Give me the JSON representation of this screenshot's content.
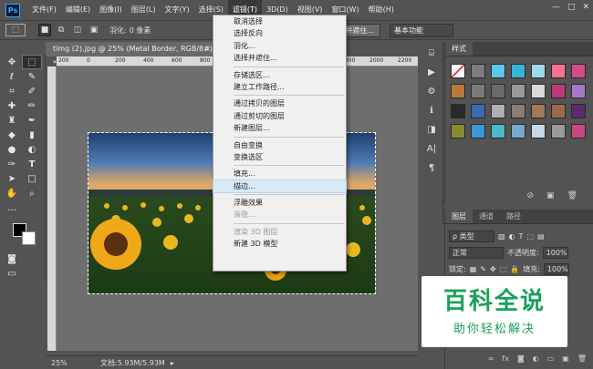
{
  "app": {
    "logo": "Ps"
  },
  "menubar": {
    "items": [
      "文件(F)",
      "编辑(E)",
      "图像(I)",
      "图层(L)",
      "文字(Y)",
      "选择(S)",
      "滤镜(T)",
      "3D(D)",
      "视图(V)",
      "窗口(W)",
      "帮助(H)"
    ],
    "active_index": 6
  },
  "window_controls": {
    "minimize": "—",
    "maximize": "□",
    "close": "✕"
  },
  "options_bar": {
    "feather_label": "羽化:",
    "feather_value": "0 像素",
    "select_mask_button": "选择并遮住...",
    "workspace": "基本功能"
  },
  "document": {
    "tab_title": "timg (2).jpg @ 25% (Metal Border, RGB/8#) *",
    "zoom": "25%",
    "doc_info": "文档:5.93M/5.93M",
    "ruler_ticks": [
      "200",
      "0",
      "200",
      "400",
      "600",
      "800",
      "1000",
      "1200",
      "1400",
      "1600",
      "1800",
      "2000",
      "2200"
    ]
  },
  "context_menu": {
    "groups": [
      [
        {
          "label": "取消选择"
        },
        {
          "label": "选择反向"
        },
        {
          "label": "羽化..."
        },
        {
          "label": "选择并遮住..."
        }
      ],
      [
        {
          "label": "存储选区..."
        },
        {
          "label": "建立工作路径..."
        }
      ],
      [
        {
          "label": "通过拷贝的图层"
        },
        {
          "label": "通过剪切的图层"
        },
        {
          "label": "新建图层..."
        }
      ],
      [
        {
          "label": "自由变换"
        },
        {
          "label": "变换选区"
        }
      ],
      [
        {
          "label": "填充..."
        },
        {
          "label": "描边...",
          "highlighted": true
        }
      ],
      [
        {
          "label": "浮雕效果"
        },
        {
          "label": "渐隐...",
          "disabled": true
        }
      ],
      [
        {
          "label": "渲染 3D 图层",
          "disabled": true
        },
        {
          "label": "新建 3D 模型"
        }
      ]
    ]
  },
  "styles_panel": {
    "tab": "样式",
    "swatches": [
      "#ffffff",
      "#7d7d7d",
      "#5ac8e8",
      "#35b6d6",
      "#9ed9e8",
      "#ff6f8f",
      "#d64a8a",
      "#b87a3a",
      "#7a7a7a",
      "#6a6a6a",
      "#9a9a9a",
      "#d9d9d9",
      "#c0367a",
      "#a878c8",
      "#2a2a2a",
      "#3a6ab0",
      "#b0b0b0",
      "#8a7e70",
      "#a07a5a",
      "#9a6a4a",
      "#5a2a6a",
      "#8a8a30",
      "#3a98d8",
      "#4ab8c8",
      "#78a8d0",
      "#c8d8e8",
      "#9a9a9a",
      "#c84880"
    ]
  },
  "layers_panel": {
    "tabs": [
      "图层",
      "通道",
      "路径"
    ],
    "filter_label": "ρ 类型",
    "blend_mode": "正常",
    "opacity_label": "不透明度:",
    "opacity_value": "100%",
    "lock_label": "锁定:",
    "fill_label": "填充:",
    "fill_value": "100%"
  },
  "watermark": {
    "title": "百科全说",
    "subtitle": "助你轻松解决"
  }
}
